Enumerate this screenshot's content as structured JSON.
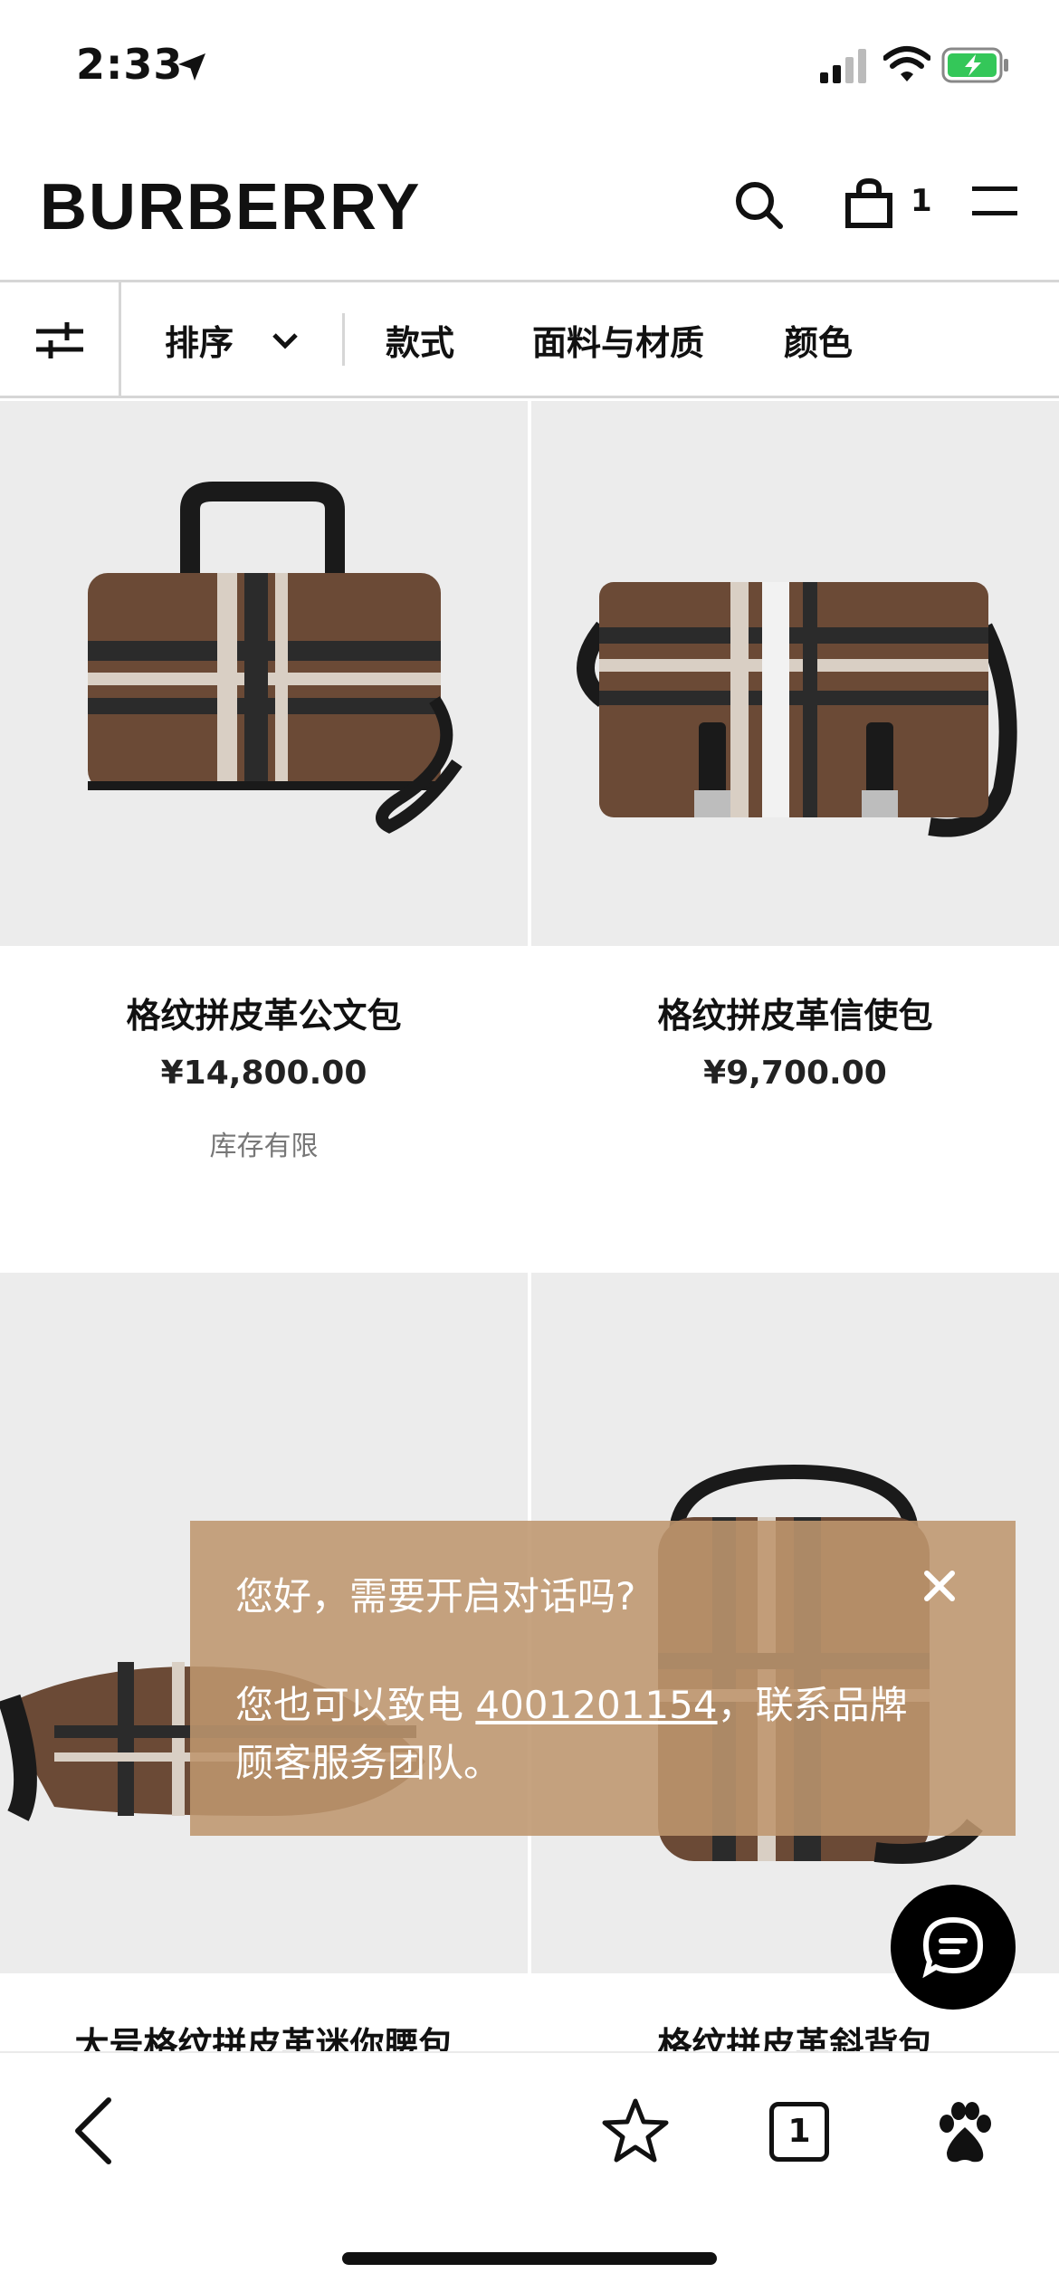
{
  "status_bar": {
    "time": "2:33"
  },
  "header": {
    "brand": "BURBERRY",
    "bag_count": "1"
  },
  "filter_bar": {
    "sort_label": "排序",
    "options": [
      "款式",
      "面料与材质",
      "颜色"
    ]
  },
  "products": [
    {
      "name": "格纹拼皮革公文包",
      "price": "¥14,800.00",
      "stock": "库存有限"
    },
    {
      "name": "格纹拼皮革信使包",
      "price": "¥9,700.00",
      "stock": ""
    },
    {
      "name": "大号格纹拼皮革迷你腰包",
      "price": "",
      "stock": ""
    },
    {
      "name": "格纹拼皮革斜背包",
      "price": "",
      "stock": ""
    }
  ],
  "chat_popup": {
    "title": "您好，需要开启对话吗?",
    "body_prefix": "您也可以致电 ",
    "phone": "4001201154",
    "body_suffix": "，联系品牌顾客服务团队。"
  },
  "browser_toolbar": {
    "tab_count": "1"
  },
  "colors": {
    "popup_bg": "#be966e",
    "check_brown": "#6b4a36"
  },
  "icons": [
    "location-arrow-icon",
    "signal-icon",
    "wifi-icon",
    "battery-charging-icon",
    "search-icon",
    "shopping-bag-icon",
    "menu-icon",
    "filter-sliders-icon",
    "chevron-down-icon",
    "close-icon",
    "chat-icon",
    "back-arrow-icon",
    "star-icon",
    "tabs-icon",
    "baidu-paw-icon"
  ]
}
